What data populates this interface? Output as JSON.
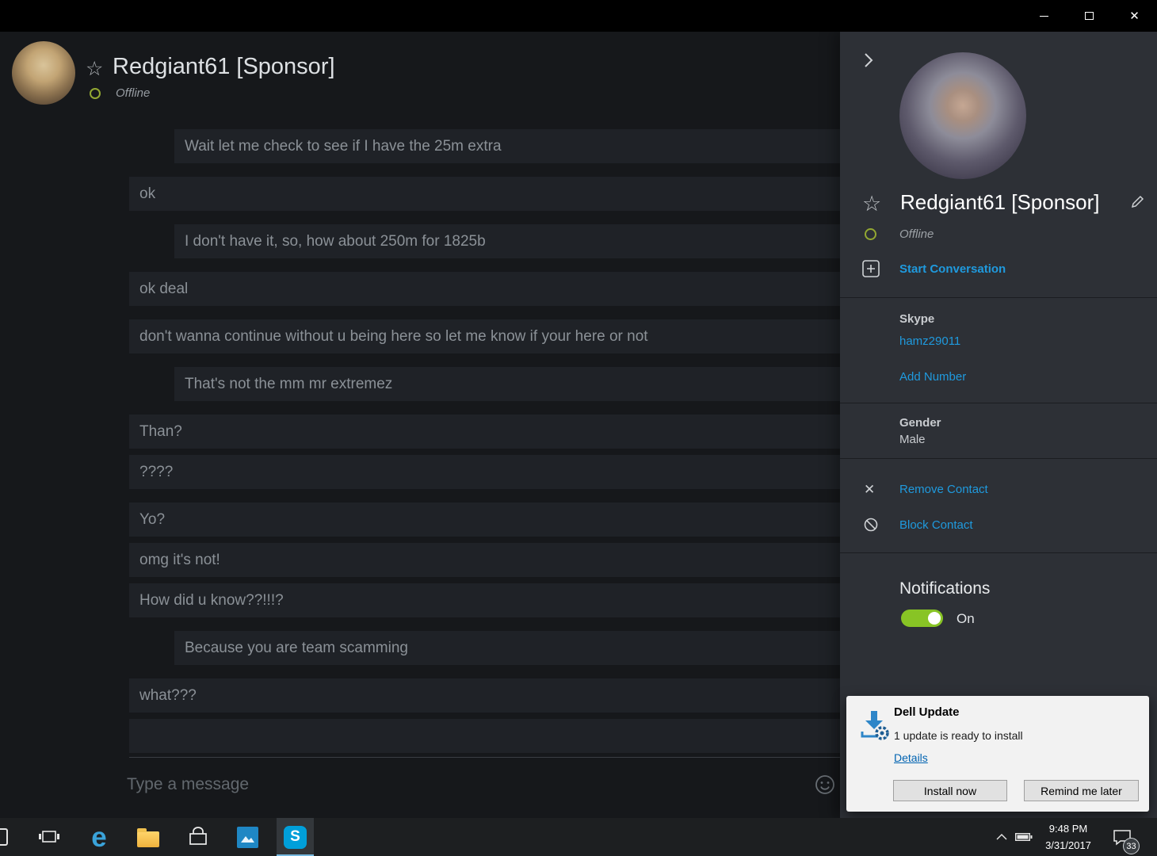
{
  "window": {
    "controls": {
      "close_glyph": "✕"
    }
  },
  "icons": {
    "star": "☆",
    "close_glyph": "✕",
    "remove_glyph": "✕",
    "edge_glyph": "e",
    "skype_glyph": "S"
  },
  "chat": {
    "header": {
      "name": "Redgiant61 [Sponsor]",
      "status": "Offline"
    },
    "messages": [
      {
        "text": "Wait let me check to see if I have the 25m extra",
        "sent": true,
        "grouped": false
      },
      {
        "text": "ok",
        "sent": false,
        "grouped": false
      },
      {
        "text": "I don't have it, so, how about 250m for 1825b",
        "sent": true,
        "grouped": false
      },
      {
        "text": "ok deal",
        "sent": false,
        "grouped": false
      },
      {
        "text": "don't wanna continue without u being here so let me know if your here or not",
        "sent": false,
        "grouped": false
      },
      {
        "text": "That's not the mm mr extremez",
        "sent": true,
        "grouped": false
      },
      {
        "text": "Than?",
        "sent": false,
        "grouped": false
      },
      {
        "text": "????",
        "sent": false,
        "grouped": true
      },
      {
        "text": "Yo?",
        "sent": false,
        "grouped": false
      },
      {
        "text": "omg it's not!",
        "sent": false,
        "grouped": true
      },
      {
        "text": "How did u know??!!!?",
        "sent": false,
        "grouped": true
      },
      {
        "text": "Because you are team scamming",
        "sent": true,
        "grouped": false
      },
      {
        "text": "what???",
        "sent": false,
        "grouped": false
      },
      {
        "text": "",
        "sent": false,
        "grouped": true
      }
    ],
    "input_placeholder": "Type a message"
  },
  "profile": {
    "name": "Redgiant61 [Sponsor]",
    "status": "Offline",
    "start_conversation": "Start Conversation",
    "skype_label": "Skype",
    "skype_id": "hamz29011",
    "add_number": "Add Number",
    "gender_label": "Gender",
    "gender_value": "Male",
    "remove_contact": "Remove Contact",
    "block_contact": "Block Contact",
    "notifications_label": "Notifications",
    "notifications_state": "On"
  },
  "dell_update": {
    "title": "Dell Update",
    "message": "1 update is ready to install",
    "details": "Details",
    "install_button": "Install now",
    "remind_button": "Remind me later"
  },
  "taskbar": {
    "time": "9:48 PM",
    "date": "3/31/2017",
    "notification_badge": "33"
  }
}
